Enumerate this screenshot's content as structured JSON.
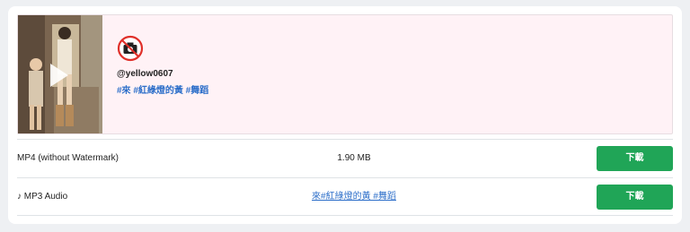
{
  "result": {
    "username": "@yellow0607",
    "hashtags": "#來 #紅綠燈的黃 #舞蹈",
    "avatar_icon": "no-camera-icon"
  },
  "downloads": [
    {
      "label": "MP4 (without Watermark)",
      "info": "1.90 MB",
      "button": "下載"
    },
    {
      "label": "♪ MP3 Audio",
      "info": "來#紅綠燈的黃 #舞蹈",
      "button": "下載"
    }
  ],
  "colors": {
    "accent": "#20a557",
    "link": "#2c6ec9",
    "media_bg": "#fff2f6"
  }
}
